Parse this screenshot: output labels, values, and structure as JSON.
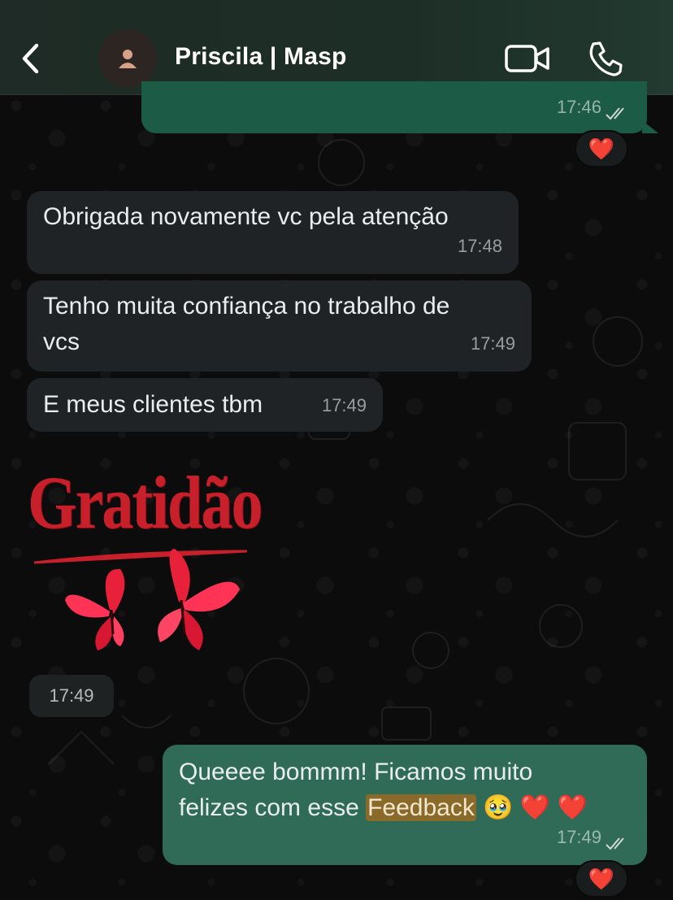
{
  "header": {
    "contact_name": "Priscila | Masp",
    "back_icon": "chevron-left-icon",
    "avatar_icon": "person-icon",
    "video_icon": "video-camera-icon",
    "call_icon": "phone-icon"
  },
  "messages": [
    {
      "direction": "outgoing",
      "text": "",
      "time": "17:46",
      "status": "read",
      "reaction": "❤️"
    },
    {
      "direction": "incoming",
      "text": "Obrigada novamente vc pela atenção",
      "time": "17:48"
    },
    {
      "direction": "incoming",
      "line1": "Tenho muita confiança no trabalho de",
      "line2": "vcs",
      "time": "17:49"
    },
    {
      "direction": "incoming",
      "text": "E meus clientes tbm",
      "time": "17:49"
    },
    {
      "direction": "incoming",
      "type": "sticker",
      "sticker_text": "Gratidão",
      "time": "17:49"
    },
    {
      "direction": "outgoing",
      "line1": "Queeee bommm! Ficamos muito",
      "line2_pre": "felizes com esse ",
      "highlight": "Feedback",
      "emojis": "🥹 ❤️ ❤️",
      "time": "17:49",
      "status": "read",
      "reaction": "❤️"
    }
  ],
  "colors": {
    "header_bg": "#1f2b26",
    "incoming_bubble": "#202325",
    "outgoing_bubble": "#1c5b45",
    "highlight": "#8a6a2a",
    "sticker_red": "#c8202b"
  }
}
